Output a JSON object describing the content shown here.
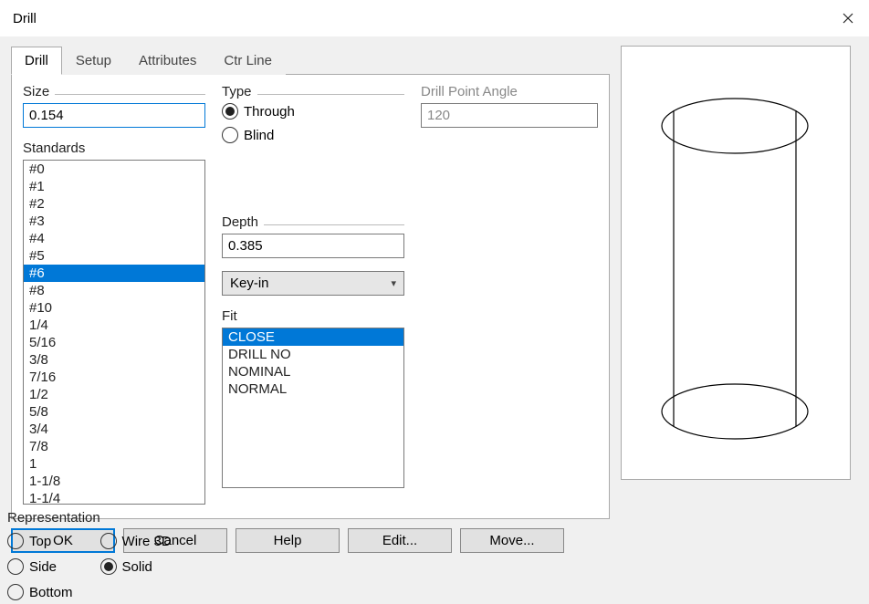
{
  "window": {
    "title": "Drill"
  },
  "tabs": [
    "Drill",
    "Setup",
    "Attributes",
    "Ctr Line"
  ],
  "active_tab": 0,
  "size": {
    "label": "Size",
    "value": "0.154"
  },
  "standards": {
    "label": "Standards",
    "items": [
      "#0",
      "#1",
      "#2",
      "#3",
      "#4",
      "#5",
      "#6",
      "#8",
      "#10",
      "1/4",
      "5/16",
      "3/8",
      "7/16",
      "1/2",
      "5/8",
      "3/4",
      "7/8",
      "1",
      "1-1/8",
      "1-1/4"
    ],
    "selected_index": 6
  },
  "type": {
    "label": "Type",
    "options": [
      "Through",
      "Blind"
    ],
    "selected_index": 0
  },
  "drill_point_angle": {
    "label": "Drill Point Angle",
    "value": "120",
    "enabled": false
  },
  "depth": {
    "label": "Depth",
    "value": "0.385",
    "combo": "Key-in"
  },
  "fit": {
    "label": "Fit",
    "items": [
      "CLOSE",
      "DRILL NO",
      "NOMINAL",
      "NORMAL"
    ],
    "selected_index": 0
  },
  "buttons": {
    "ok": "OK",
    "cancel": "Cancel",
    "help": "Help",
    "edit": "Edit...",
    "move": "Move..."
  },
  "representation": {
    "label": "Representation",
    "left_options": [
      "Top",
      "Side",
      "Bottom"
    ],
    "right_options": [
      "Wire 3D",
      "Solid"
    ],
    "selected": "Solid"
  }
}
